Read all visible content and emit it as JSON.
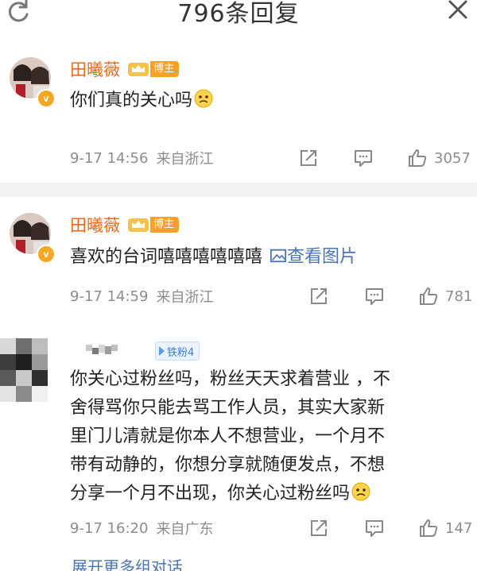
{
  "header": {
    "title": "796条回复"
  },
  "comments": [
    {
      "author": "田曦薇",
      "badge": "博主",
      "text": "你们真的关心吗",
      "time": "9-17 14:56",
      "location": "来自浙江",
      "likes": "3057"
    },
    {
      "author": "田曦薇",
      "badge": "博主",
      "text": "喜欢的台词嘻嘻嘻嘻嘻嘻",
      "link_text": "查看图片",
      "time": "9-17 14:59",
      "location": "来自浙江",
      "likes": "781"
    },
    {
      "fan_badge": "铁粉4",
      "lines": [
        "你关心过粉丝吗，粉丝天天求着营业 ，不",
        "舍得骂你只能去骂工作人员，其实大家新",
        "里门儿清就是你本人不想营业，一个月不",
        "带有动静的，你想分享就随便发点，不想",
        "分享一个月不出现，你关心过粉丝吗"
      ],
      "time": "9-17 16:20",
      "location": "来自广东",
      "likes": "147"
    }
  ],
  "footer": {
    "expand_label": "展开更多组对话"
  },
  "colors": {
    "author": "#e86a19",
    "link": "#4a74b6",
    "meta": "#8c8c8c",
    "badge_bg": "#f7a12c",
    "fan_badge": "#3b7fd6"
  },
  "icons": [
    "refresh-icon",
    "close-icon",
    "crown-icon",
    "share-icon",
    "comment-icon",
    "like-icon",
    "sad-emoji-icon",
    "image-icon"
  ]
}
